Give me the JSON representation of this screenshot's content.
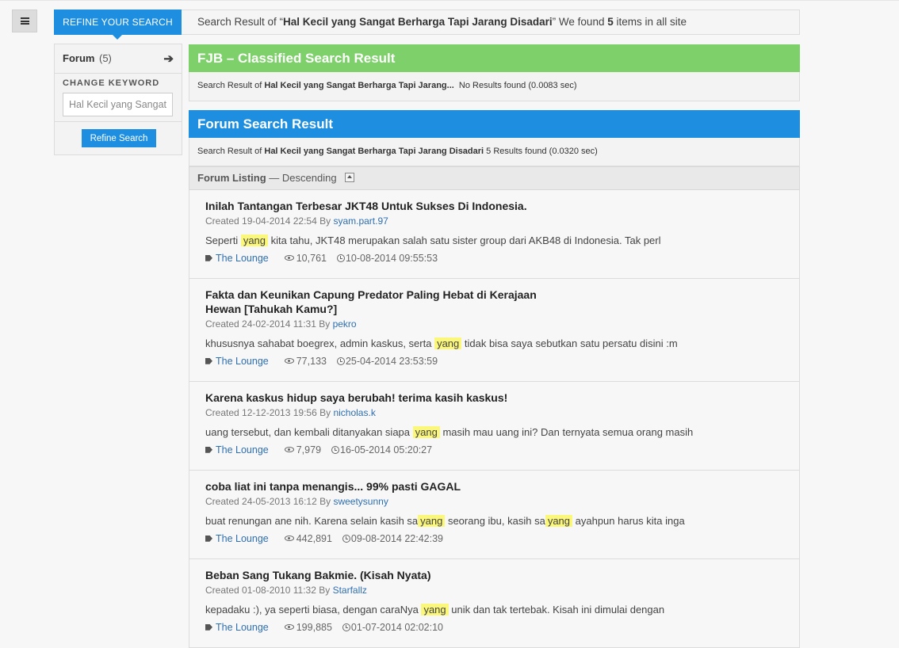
{
  "menu_icon": "hamburger-icon",
  "topbar": {
    "refine_tab": "REFINE YOUR SEARCH",
    "summary_prefix": "Search Result of “",
    "summary_query": "Hal Kecil yang Sangat Berharga Tapi Jarang Disadari",
    "summary_mid": "” We found ",
    "summary_count": "5",
    "summary_suffix": " items in all site"
  },
  "sidebar": {
    "forum_label": "Forum",
    "forum_count": "(5)",
    "forum_arrow": "➔",
    "change_keyword_label": "CHANGE KEYWORD",
    "keyword_value": "Hal Kecil yang Sangat Berharga Tapi Jarang Disadari",
    "refine_button": "Refine Search"
  },
  "fjb": {
    "title": "FJB – Classified Search Result",
    "prefix": "Search Result of ",
    "query": "Hal Kecil yang Sangat Berharga Tapi Jarang...",
    "status": "  No Results found (0.0083 sec)",
    "color": "#7ed06a"
  },
  "forum_result": {
    "title": "Forum Search Result",
    "prefix": "Search Result of ",
    "query": "Hal Kecil yang Sangat Berharga Tapi Jarang Disadari",
    "status": " 5 Results found (0.0320 sec)",
    "color": "#1e8fe0"
  },
  "listing": {
    "label": "Forum Listing",
    "order": " — Descending"
  },
  "results": [
    {
      "title": "Inilah Tantangan Terbesar JKT48 Untuk Sukses Di Indonesia.",
      "created": "Created 19-04-2014 22:54 By ",
      "author": "syam.part.97",
      "snippet_before": "Seperti ",
      "highlight": "yang",
      "snippet_after": " kita tahu, JKT48 merupakan salah satu sister group dari AKB48 di Indonesia. Tak perl",
      "category": "The Lounge",
      "views": "10,761",
      "last_post": "10-08-2014 09:55:53"
    },
    {
      "title": "Fakta dan Keunikan Capung Predator Paling Hebat di Kerajaan Hewan [Tahukah Kamu?]",
      "created": "Created 24-02-2014 11:31 By ",
      "author": "pekro",
      "snippet_before": "khususnya sahabat boegrex, admin kaskus, serta ",
      "highlight": "yang",
      "snippet_after": " tidak bisa saya sebutkan satu persatu disini :m",
      "category": "The Lounge",
      "views": "77,133",
      "last_post": "25-04-2014 23:53:59"
    },
    {
      "title": "Karena kaskus hidup saya berubah! terima kasih kaskus!",
      "created": "Created 12-12-2013 19:56 By ",
      "author": "nicholas.k",
      "snippet_before": "uang tersebut, dan kembali ditanyakan siapa ",
      "highlight": "yang",
      "snippet_after": " masih mau uang ini? Dan ternyata semua orang masih",
      "category": "The Lounge",
      "views": "7,979",
      "last_post": "16-05-2014 05:20:27"
    },
    {
      "title": "coba liat ini tanpa menangis... 99% pasti GAGAL",
      "created": "Created 24-05-2013 16:12 By ",
      "author": "sweetysunny",
      "snippet_before": "buat renungan ane nih. Karena selain kasih sa",
      "highlight": "yang",
      "snippet_mid": " seorang ibu, kasih sa",
      "highlight2": "yang",
      "snippet_after": " ayahpun harus kita inga",
      "category": "The Lounge",
      "views": "442,891",
      "last_post": "09-08-2014 22:42:39"
    },
    {
      "title": "Beban Sang Tukang Bakmie. (Kisah Nyata)",
      "created": "Created 01-08-2010 11:32 By ",
      "author": "Starfallz",
      "snippet_before": "kepadaku :), ya seperti biasa, dengan caraNya ",
      "highlight": "yang",
      "snippet_after": " unik dan tak tertebak. Kisah ini dimulai dengan",
      "category": "The Lounge",
      "views": "199,885",
      "last_post": "01-07-2014 02:02:10"
    }
  ]
}
